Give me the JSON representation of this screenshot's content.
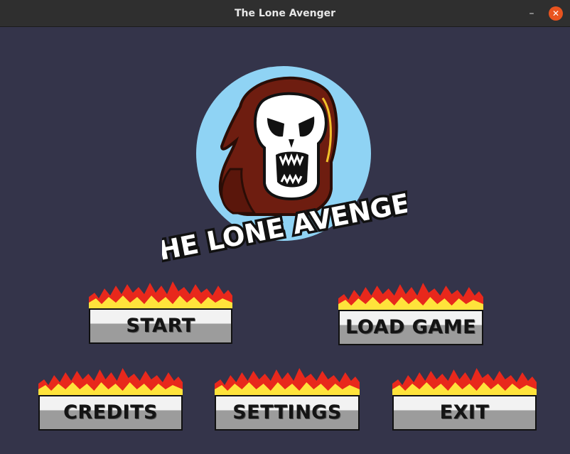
{
  "window": {
    "title": "The Lone Avenger",
    "minimize_symbol": "–",
    "close_symbol": "✕"
  },
  "logo": {
    "text": "THE LONE AVENGER",
    "icon": "skull-reaper-icon",
    "circle_color": "#8fd3f4",
    "hood_color": "#6e1d10"
  },
  "menu": {
    "start": "START",
    "load_game": "LOAD GAME",
    "credits": "CREDITS",
    "settings": "SETTINGS",
    "exit": "EXIT"
  },
  "colors": {
    "background": "#34344a",
    "titlebar": "#2f2f2f",
    "close_button": "#e9541f",
    "flame_red": "#e8281c",
    "flame_yellow": "#ffe33b"
  }
}
